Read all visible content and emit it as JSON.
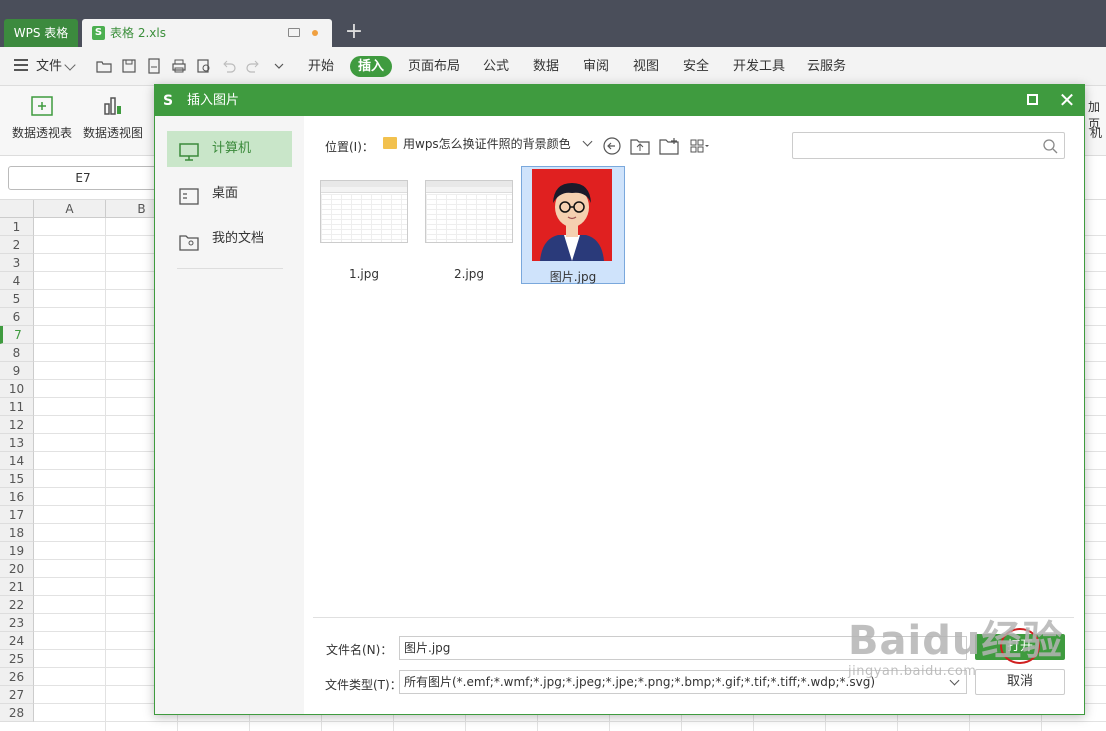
{
  "titlebar": {
    "app_tab": "WPS 表格",
    "doc_tab": "表格 2.xls",
    "doc_icon_letter": "S",
    "add_tab": "+"
  },
  "menubar": {
    "file": "文件",
    "items": [
      "开始",
      "插入",
      "页面布局",
      "公式",
      "数据",
      "审阅",
      "视图",
      "安全",
      "开发工具",
      "云服务"
    ],
    "active": "插入"
  },
  "ribbon": {
    "buttons": [
      "数据透视表",
      "数据透视图"
    ],
    "right_partial_1": "加页",
    "right_partial_2": "机"
  },
  "formula": {
    "namebox": "E7"
  },
  "grid": {
    "columns": [
      "A",
      "B"
    ],
    "rows": [
      "1",
      "2",
      "3",
      "4",
      "5",
      "6",
      "7",
      "8",
      "9",
      "10",
      "11",
      "12",
      "13",
      "14",
      "15",
      "16",
      "17",
      "18",
      "19",
      "20",
      "21",
      "22",
      "23",
      "24",
      "25",
      "26",
      "27",
      "28"
    ],
    "selected_row": "7"
  },
  "dialog": {
    "title": "插入图片",
    "logo": "S",
    "close": "✕",
    "sidebar": [
      "计算机",
      "桌面",
      "我的文档"
    ],
    "location_label": "位置(I)：",
    "location_path": "用wps怎么换证件照的背景颜色",
    "files": [
      "1.jpg",
      "2.jpg",
      "图片.jpg"
    ],
    "selected_file": "图片.jpg",
    "filename_label": "文件名(N)：",
    "filename_value": "图片.jpg",
    "filetype_label": "文件类型(T)：",
    "filetype_value": "所有图片(*.emf;*.wmf;*.jpg;*.jpeg;*.jpe;*.png;*.bmp;*.gif;*.tif;*.tiff;*.wdp;*.svg)",
    "open_button": "打开",
    "cancel_button": "取消"
  },
  "watermark": {
    "main": "Baidu经验",
    "sub": "jingyan.baidu.com"
  },
  "colors": {
    "accent": "#3f9b3f",
    "titlebar": "#4a4e5a",
    "photo_bg": "#e02020"
  }
}
